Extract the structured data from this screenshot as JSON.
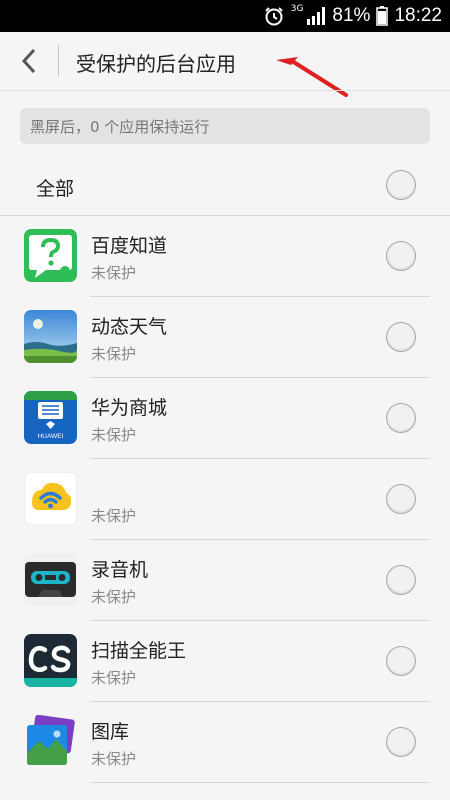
{
  "status_bar": {
    "network": "3G",
    "battery": "81%",
    "time": "18:22",
    "icons": [
      "alarm-icon",
      "signal-icon",
      "battery-icon"
    ]
  },
  "header": {
    "title": "受保护的后台应用",
    "back_icon": "chevron-left-icon"
  },
  "hint": "黑屏后，0 个应用保持运行",
  "select_all": {
    "label": "全部",
    "checked": false
  },
  "apps": [
    {
      "name": "百度知道",
      "status": "未保护",
      "icon": "baidu-zhidao-icon",
      "checked": false
    },
    {
      "name": "动态天气",
      "status": "未保护",
      "icon": "weather-icon",
      "checked": false
    },
    {
      "name": "华为商城",
      "status": "未保护",
      "icon": "huawei-store-icon",
      "checked": false
    },
    {
      "name": "",
      "status": "未保护",
      "icon": "wifi-app-icon",
      "checked": false
    },
    {
      "name": "录音机",
      "status": "未保护",
      "icon": "recorder-icon",
      "checked": false
    },
    {
      "name": "扫描全能王",
      "status": "未保护",
      "icon": "camscanner-icon",
      "checked": false
    },
    {
      "name": "图库",
      "status": "未保护",
      "icon": "gallery-icon",
      "checked": false
    }
  ],
  "colors": {
    "background": "#f5f5f5",
    "status_bar": "#000000",
    "annotation_arrow": "#e02020"
  }
}
